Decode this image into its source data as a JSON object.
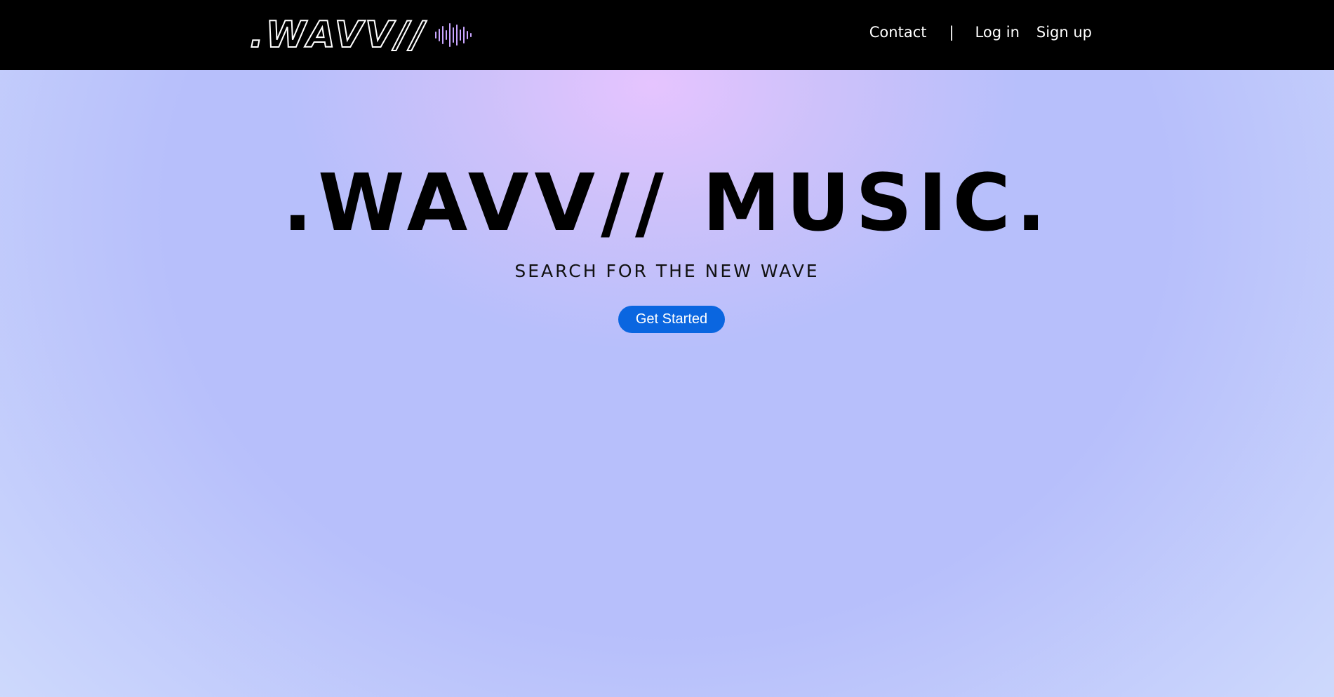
{
  "header": {
    "logo_text": ".WAVV//",
    "logo_icon": "soundwave-icon",
    "nav": {
      "contact": "Contact",
      "separator": "|",
      "login": "Log in",
      "signup": "Sign up"
    }
  },
  "hero": {
    "title": ".WAVV// MUSIC.",
    "tagline": "SEARCH FOR THE NEW WAVE",
    "cta_label": "Get Started"
  },
  "colors": {
    "header_bg": "#000000",
    "accent": "#0a66e0",
    "hero_bg": "#b7bffb",
    "hero_glow": "#e8c4ff"
  }
}
